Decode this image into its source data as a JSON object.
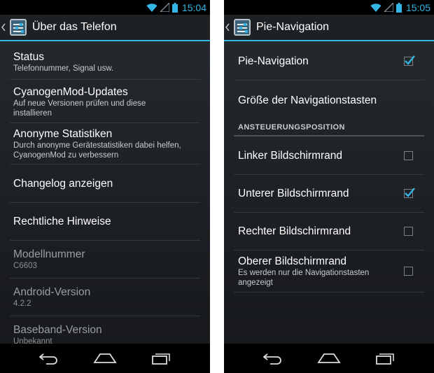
{
  "colors": {
    "accent": "#33b5e5",
    "background": "#1c1f23",
    "statusbar": "#000000",
    "navbar": "#000000"
  },
  "left": {
    "status": {
      "time": "15:04"
    },
    "title": "Über das Telefon",
    "items": [
      {
        "title": "Status",
        "subtitle": "Telefonnummer, Signal usw."
      },
      {
        "title": "CyanogenMod-Updates",
        "subtitle_line1": "Auf neue Versionen prüfen und diese",
        "subtitle_line2": "installieren"
      },
      {
        "title": "Anonyme Statistiken",
        "subtitle_line1": "Durch anonyme Gerätestatistiken dabei helfen,",
        "subtitle_line2": "CyanogenMod zu verbessern"
      },
      {
        "title": "Changelog anzeigen"
      },
      {
        "title": "Rechtliche Hinweise"
      },
      {
        "title": "Modellnummer",
        "subtitle": "C6603"
      },
      {
        "title": "Android-Version",
        "subtitle": "4.2.2"
      },
      {
        "title": "Baseband-Version",
        "subtitle": "Unbekannt"
      }
    ]
  },
  "right": {
    "status": {
      "time": "15:05"
    },
    "title": "Pie-Navigation",
    "items": [
      {
        "title": "Pie-Navigation",
        "checked": true
      },
      {
        "title": "Größe der Navigationstasten"
      }
    ],
    "category": "ANSTEUERUNGSPOSITION",
    "positions": [
      {
        "title": "Linker Bildschirmrand",
        "checked": false
      },
      {
        "title": "Unterer Bildschirmrand",
        "checked": true
      },
      {
        "title": "Rechter Bildschirmrand",
        "checked": false
      },
      {
        "title": "Oberer Bildschirmrand",
        "subtitle_line1": "Es werden nur die Navigationstasten",
        "subtitle_line2": "angezeigt",
        "checked": false
      }
    ]
  },
  "navbar": {
    "icons": [
      "back-icon",
      "home-icon",
      "recent-apps-icon"
    ]
  }
}
